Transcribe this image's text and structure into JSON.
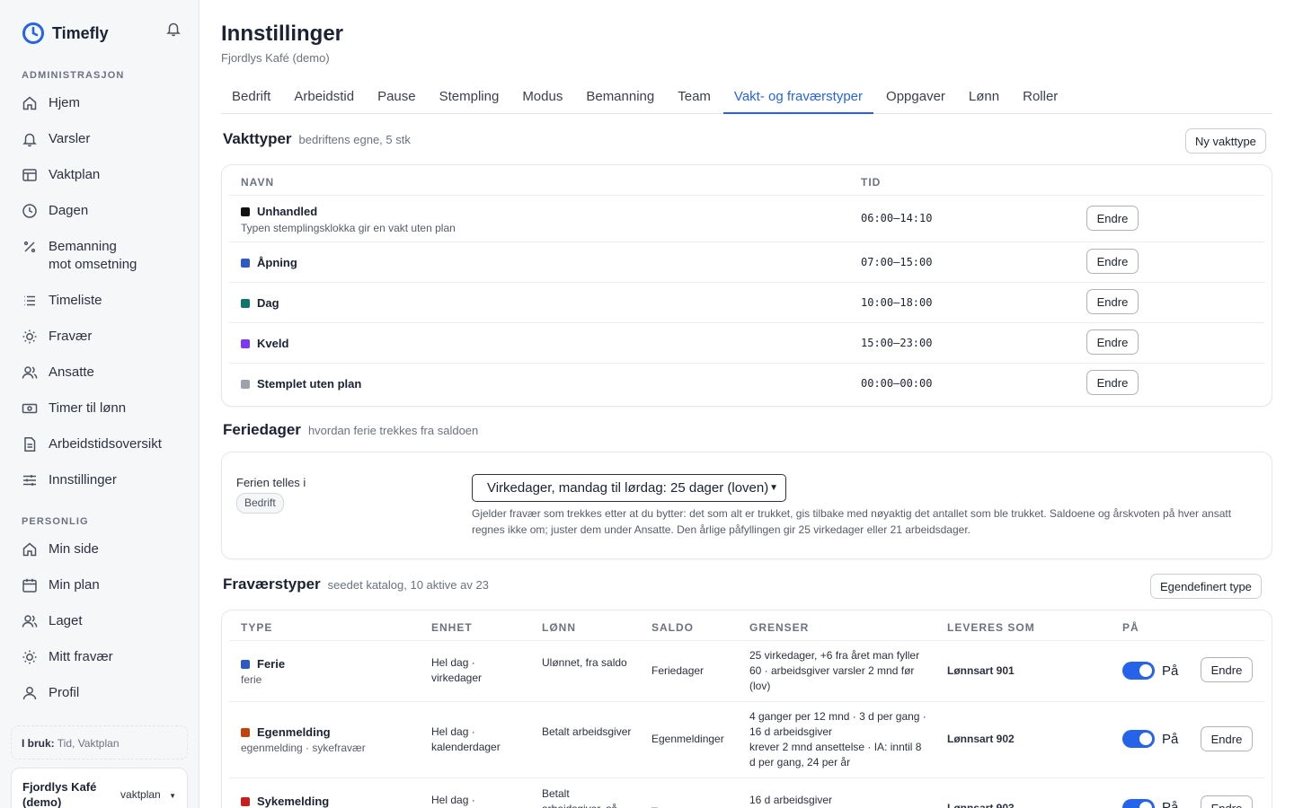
{
  "app": {
    "name": "Timefly"
  },
  "colors": {
    "accent": "#2563eb"
  },
  "sidebar": {
    "section_admin": "ADMINISTRASJON",
    "admin_items": [
      {
        "label": "Hjem",
        "icon": "home-icon"
      },
      {
        "label": "Varsler",
        "icon": "bell-icon"
      },
      {
        "label": "Vaktplan",
        "icon": "table-icon"
      },
      {
        "label": "Dagen",
        "icon": "clock-icon"
      },
      {
        "label": "Bemanning\nmot omsetning",
        "icon": "percent-icon"
      },
      {
        "label": "Timeliste",
        "icon": "list-icon"
      },
      {
        "label": "Fravær",
        "icon": "sun-icon"
      },
      {
        "label": "Ansatte",
        "icon": "users-icon"
      },
      {
        "label": "Timer til lønn",
        "icon": "money-icon"
      },
      {
        "label": "Arbeidstidsoversikt",
        "icon": "document-icon"
      },
      {
        "label": "Innstillinger",
        "icon": "sliders-icon"
      }
    ],
    "section_personal": "PERSONLIG",
    "personal_items": [
      {
        "label": "Min side",
        "icon": "home-icon"
      },
      {
        "label": "Min plan",
        "icon": "calendar-icon"
      },
      {
        "label": "Laget",
        "icon": "users-icon"
      },
      {
        "label": "Mitt fravær",
        "icon": "sun-icon"
      },
      {
        "label": "Profil",
        "icon": "user-icon"
      }
    ],
    "in_use_label": "I bruk:",
    "in_use_value": "Tid, Vaktplan",
    "org_name": "Fjordlys Kafé (demo)",
    "org_switch": "vaktplan"
  },
  "page": {
    "title": "Innstillinger",
    "subtitle": "Fjordlys Kafé (demo)",
    "tabs": [
      "Bedrift",
      "Arbeidstid",
      "Pause",
      "Stempling",
      "Modus",
      "Bemanning",
      "Team",
      "Vakt- og fraværstyper",
      "Oppgaver",
      "Lønn",
      "Roller"
    ],
    "active_tab": "Vakt- og fraværstyper"
  },
  "shift_types": {
    "title": "Vakttyper",
    "note": "bedriftens egne, 5 stk",
    "new_button": "Ny vakttype",
    "col_name": "NAVN",
    "col_time": "TID",
    "edit_label": "Endre",
    "rows": [
      {
        "name": "Unhandled",
        "desc": "Typen stemplingsklokka gir en vakt uten plan",
        "time": "06:00–14:10",
        "color": "#111111"
      },
      {
        "name": "Åpning",
        "desc": "",
        "time": "07:00–15:00",
        "color": "#2e5bbf"
      },
      {
        "name": "Dag",
        "desc": "",
        "time": "10:00–18:00",
        "color": "#0f766e"
      },
      {
        "name": "Kveld",
        "desc": "",
        "time": "15:00–23:00",
        "color": "#7c3aed"
      },
      {
        "name": "Stemplet uten plan",
        "desc": "",
        "time": "00:00–00:00",
        "color": "#9ca3af"
      }
    ]
  },
  "vacation": {
    "title": "Feriedager",
    "note": "hvordan ferie trekkes fra saldoen",
    "label": "Ferien telles i",
    "badge": "Bedrift",
    "selected": "Virkedager, mandag til lørdag: 25 dager (loven)",
    "help": "Gjelder fravær som trekkes etter at du bytter: det som alt er trukket, gis tilbake med nøyaktig det antallet som ble trukket. Saldoene og årskvoten på hver ansatt regnes ikke om; juster dem under Ansatte. Den årlige påfyllingen gir 25 virkedager eller 21 arbeidsdager."
  },
  "absence_types": {
    "title": "Fraværstyper",
    "note": "seedet katalog, 10 aktive av 23",
    "custom_button": "Egendefinert type",
    "columns": [
      "TYPE",
      "ENHET",
      "LØNN",
      "SALDO",
      "GRENSER",
      "LEVERES SOM",
      "PÅ"
    ],
    "on_label": "På",
    "edit_label": "Endre",
    "rows": [
      {
        "name": "Ferie",
        "sub": "ferie",
        "color": "#2e5bbf",
        "unit": "Hel dag · virkedager",
        "pay": "Ulønnet, fra saldo",
        "balance": "Feriedager",
        "limits": "25 virkedager, +6 fra året man fyller 60 · arbeidsgiver varsler 2 mnd før (lov)",
        "delivered": "Lønnsart 901"
      },
      {
        "name": "Egenmelding",
        "sub": "egenmelding · sykefravær",
        "color": "#c2410c",
        "unit": "Hel dag · kalenderdager",
        "pay": "Betalt arbeidsgiver",
        "balance": "Egenmeldinger",
        "limits": "4 ganger per 12 mnd · 3 d per gang · 16 d arbeidsgiver\nkrever 2 mnd ansettelse · IA: inntil 8 d per gang, 24 per år",
        "delivered": "Lønnsart 902"
      },
      {
        "name": "Sykemelding",
        "sub": "",
        "color": "#c81e1e",
        "unit": "Hel dag ·",
        "pay": "Betalt arbeidsgiver, så",
        "balance": "–",
        "limits": "16 d arbeidsgiver",
        "delivered": "Lønnsart 903"
      }
    ]
  }
}
